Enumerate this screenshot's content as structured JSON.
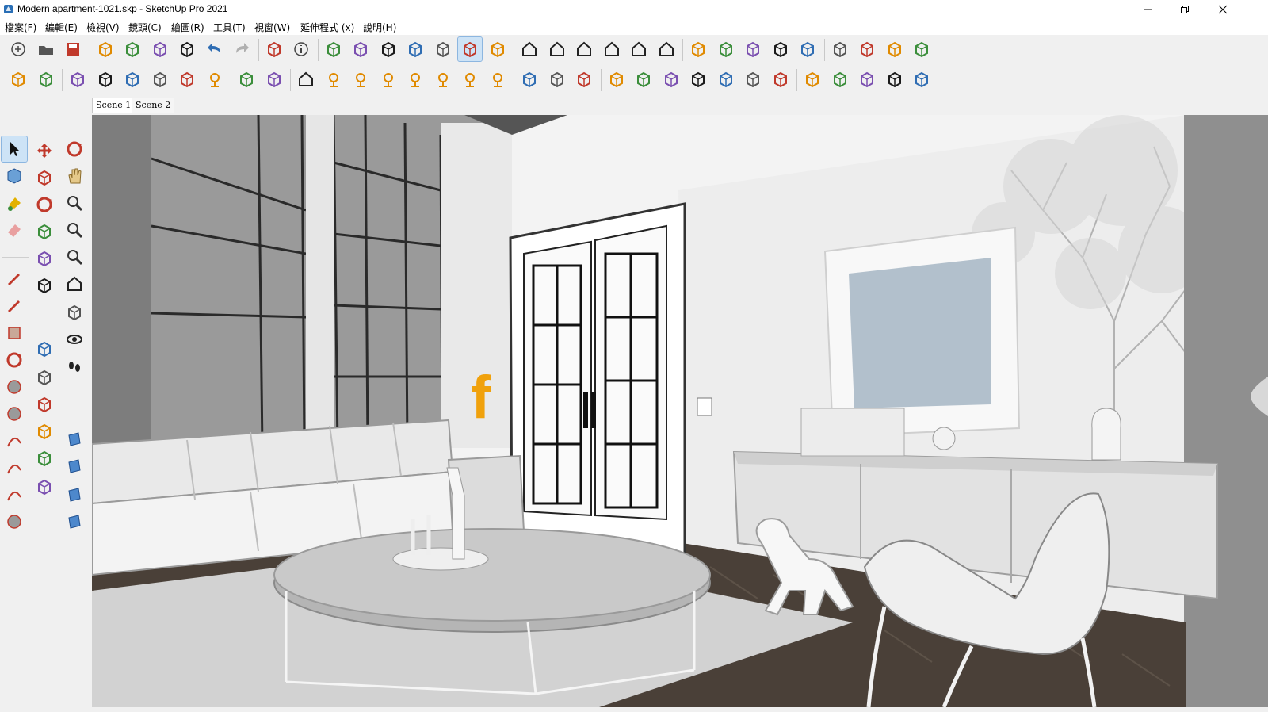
{
  "window": {
    "title": "Modern apartment-1021.skp - SketchUp Pro 2021",
    "controls": [
      "minimize",
      "restore",
      "close"
    ]
  },
  "menu": {
    "items": [
      "檔案(F)",
      "編輯(E)",
      "檢視(V)",
      "鏡頭(C)",
      "繪圖(R)",
      "工具(T)",
      "視窗(W)",
      "延伸程式 (x)",
      "說明(H)"
    ]
  },
  "toolbar_row1": {
    "icons": [
      "new-icon",
      "open-icon",
      "save-icon",
      "cut-icon",
      "copy-icon",
      "paste-icon",
      "erase-icon",
      "undo-icon",
      "redo-icon",
      "print-icon",
      "model-info-icon",
      "xray-icon",
      "back-edges-icon",
      "wireframe-icon",
      "hidden-line-icon",
      "shaded-icon",
      "shaded-textures-icon",
      "monochrome-icon",
      "iso-view-icon",
      "top-view-icon",
      "front-view-icon",
      "right-view-icon",
      "back-view-icon",
      "left-view-icon",
      "union-icon",
      "intersect-icon",
      "subtract-icon",
      "trim-icon",
      "split-icon",
      "warehouse-icon",
      "extension-warehouse-icon",
      "layout-icon",
      "sandbox-icon"
    ],
    "active": "shaded-textures-icon"
  },
  "toolbar_row2": {
    "icons": [
      "vray-asset-editor-icon",
      "vray-render-icon",
      "teapot-icon",
      "interactive-render-icon",
      "cloud-render-icon",
      "batch-render-icon",
      "frame-buffer-icon",
      "lightmix-icon",
      "region-render-icon",
      "camera-lock-icon",
      "viewport-render-icon",
      "rect-light-icon",
      "spot-light-icon",
      "sphere-light-icon",
      "ies-light-icon",
      "omni-light-icon",
      "dome-light-icon",
      "mesh-light-icon",
      "infinite-plane-icon",
      "proxy-export-icon",
      "proxy-import-icon",
      "fur-icon",
      "scatter-icon",
      "mesh-clipper-icon",
      "clipper-icon",
      "decal-icon",
      "pack-project-icon",
      "vantage-icon",
      "chaos-cosmos-icon",
      "bitmap-to-mesh-icon",
      "enmesh-icon",
      "pack-icon",
      "grid-icon"
    ]
  },
  "scene_tabs": [
    {
      "label": "Scene 1",
      "active": true
    },
    {
      "label": "Scene 2",
      "active": false
    }
  ],
  "left_tools": {
    "col1": [
      "select-icon",
      "component-icon",
      "paint-bucket-icon",
      "eraser-icon",
      "pencil-icon",
      "freehand-icon",
      "rectangle-icon",
      "rotated-rectangle-icon",
      "circle-icon",
      "polygon-icon",
      "arc-icon",
      "two-point-arc-icon",
      "three-point-arc-icon",
      "pie-icon"
    ],
    "col2": [
      "move-icon",
      "push-pull-icon",
      "rotate-icon",
      "follow-me-icon",
      "scale-icon",
      "offset-icon",
      "tape-measure-icon",
      "dimension-icon",
      "text-icon",
      "axes-icon",
      "3d-text-icon",
      "protractor-icon"
    ],
    "col3": [
      "orbit-icon",
      "pan-icon",
      "zoom-icon",
      "zoom-window-icon",
      "zoom-extents-icon",
      "previous-view-icon",
      "position-camera-icon",
      "look-around-icon",
      "walk-icon",
      "section-plane-icon",
      "section-display-icon",
      "section-cuts-icon",
      "section-fill-icon"
    ],
    "active": "select-icon"
  },
  "viewport": {
    "scene": "Living room model with sofa, coffee table, double door, mirror and console",
    "watermark_glyph": "f",
    "colors": {
      "wall": "#f4f4f4",
      "floor": "#4a4038",
      "rug": "#d9d9d9",
      "mirror_glass": "#b2c0cc",
      "watermark": "#f0a10c",
      "side_wall": "#bfbfbf"
    }
  }
}
